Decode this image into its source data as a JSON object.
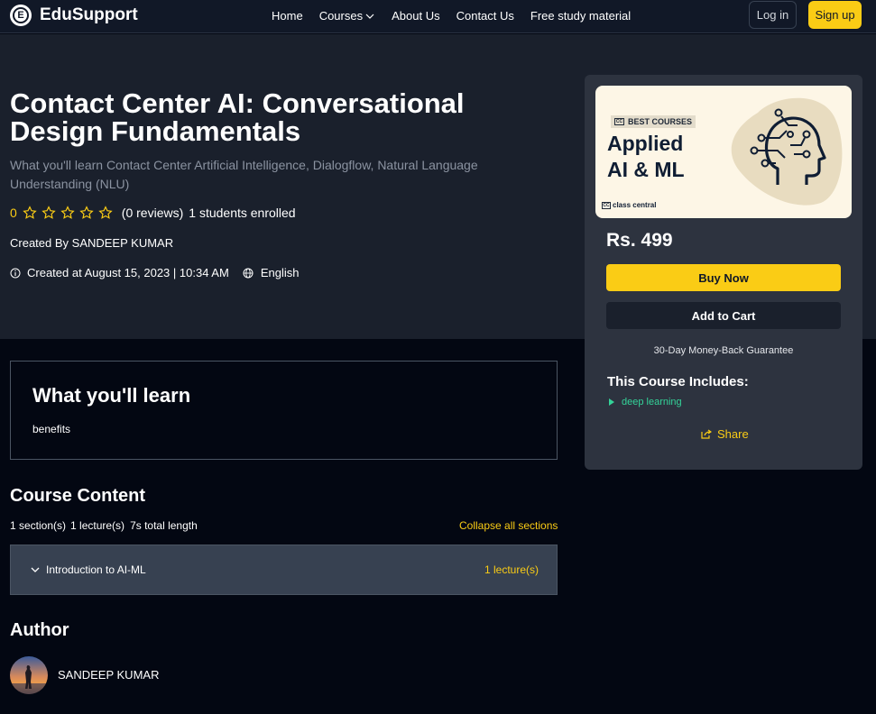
{
  "nav": {
    "brand": "EduSupport",
    "logo_letter": "E",
    "links": [
      "Home",
      "Courses",
      "About Us",
      "Contact Us",
      "Free study material"
    ],
    "login": "Log in",
    "signup": "Sign up"
  },
  "course": {
    "title": "Contact Center AI: Conversational Design Fundamentals",
    "subtitle": "What you'll learn Contact Center Artificial Intelligence, Dialogflow, Natural Language Understanding (NLU)",
    "rating": "0",
    "stars_filled": 0,
    "stars_total": 5,
    "reviews": "(0 reviews)",
    "enrolled": "1 students enrolled",
    "created_by": "Created By SANDEEP KUMAR",
    "created_at": "Created at August 15, 2023 | 10:34 AM",
    "language": "English"
  },
  "card": {
    "thumb_badge": "BEST COURSES",
    "thumb_badge_mark": "CC",
    "thumb_title_line1": "Applied",
    "thumb_title_line2": "AI & ML",
    "thumb_footer": "class central",
    "price": "Rs. 499",
    "buy": "Buy Now",
    "cart": "Add to Cart",
    "guarantee": "30-Day Money-Back Guarantee",
    "includes_heading": "This Course Includes:",
    "includes": [
      "deep learning"
    ],
    "share": "Share"
  },
  "learn": {
    "heading": "What you'll learn",
    "items": [
      "benefits"
    ]
  },
  "content": {
    "heading": "Course Content",
    "sections": "1 section(s)",
    "lectures": "1 lecture(s)",
    "length": "7s total length",
    "collapse": "Collapse all sections",
    "rows": [
      {
        "title": "Introduction to AI-ML",
        "count": "1 lecture(s)"
      }
    ]
  },
  "author": {
    "heading": "Author",
    "name": "SANDEEP KUMAR"
  },
  "colors": {
    "accent": "#facc15",
    "hero_bg": "#1a202c",
    "page_bg": "#030712",
    "card_bg": "#2d333f",
    "include_green": "#34d399"
  }
}
